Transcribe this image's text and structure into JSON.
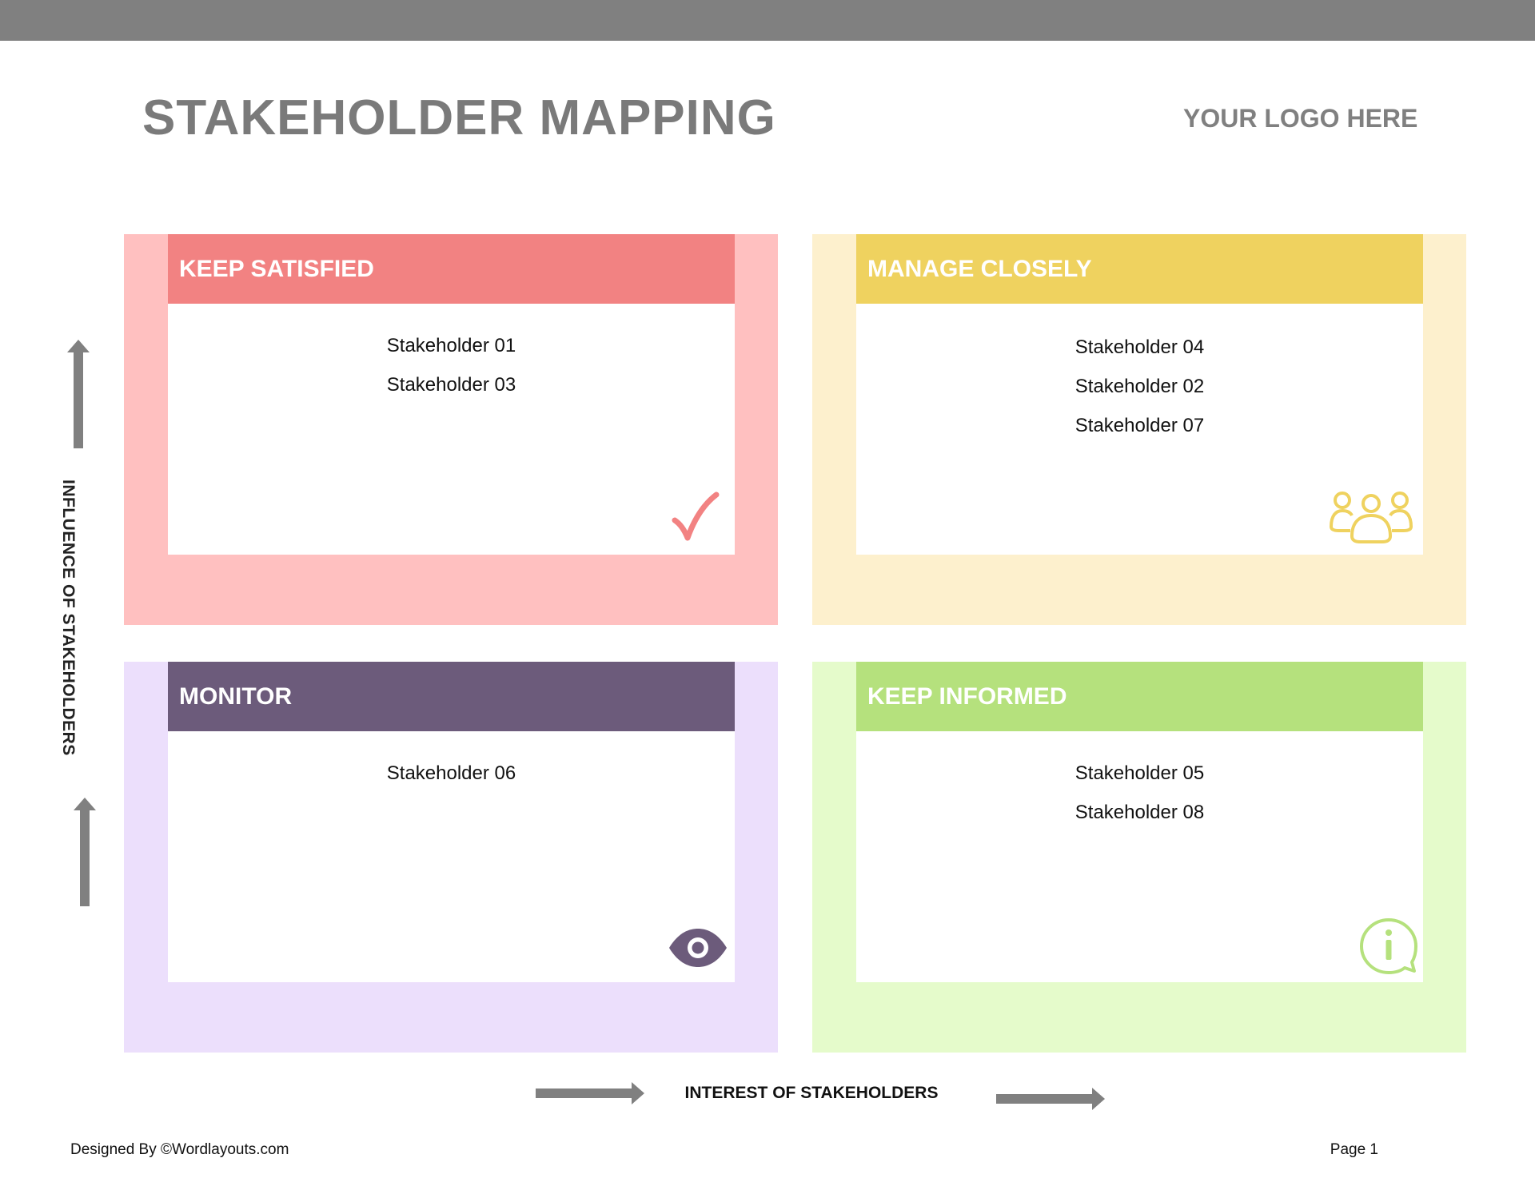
{
  "page": {
    "title": "STAKEHOLDER MAPPING",
    "logo_text": "YOUR LOGO HERE"
  },
  "quadrants": [
    {
      "label": "KEEP SATISFIED",
      "stakeholders": [
        "Stakeholder 01",
        "Stakeholder 03"
      ],
      "icon": "checkmark-icon",
      "color": "#f28282"
    },
    {
      "label": "MANAGE CLOSELY",
      "stakeholders": [
        "Stakeholder 04",
        "Stakeholder 02",
        "Stakeholder 07"
      ],
      "icon": "group-icon",
      "color": "#efd25f"
    },
    {
      "label": "MONITOR",
      "stakeholders": [
        "Stakeholder 06"
      ],
      "icon": "eye-icon",
      "color": "#6c5b7b"
    },
    {
      "label": "KEEP INFORMED",
      "stakeholders": [
        "Stakeholder 05",
        "Stakeholder 08"
      ],
      "icon": "info-bubble-icon",
      "color": "#b5e17d"
    }
  ],
  "axes": {
    "y_label": "INFLUENCE OF STAKEHOLDERS",
    "x_label": "INTEREST OF STAKEHOLDERS"
  },
  "footer": {
    "credit": "Designed By ©Wordlayouts.com",
    "page": "Page 1"
  }
}
